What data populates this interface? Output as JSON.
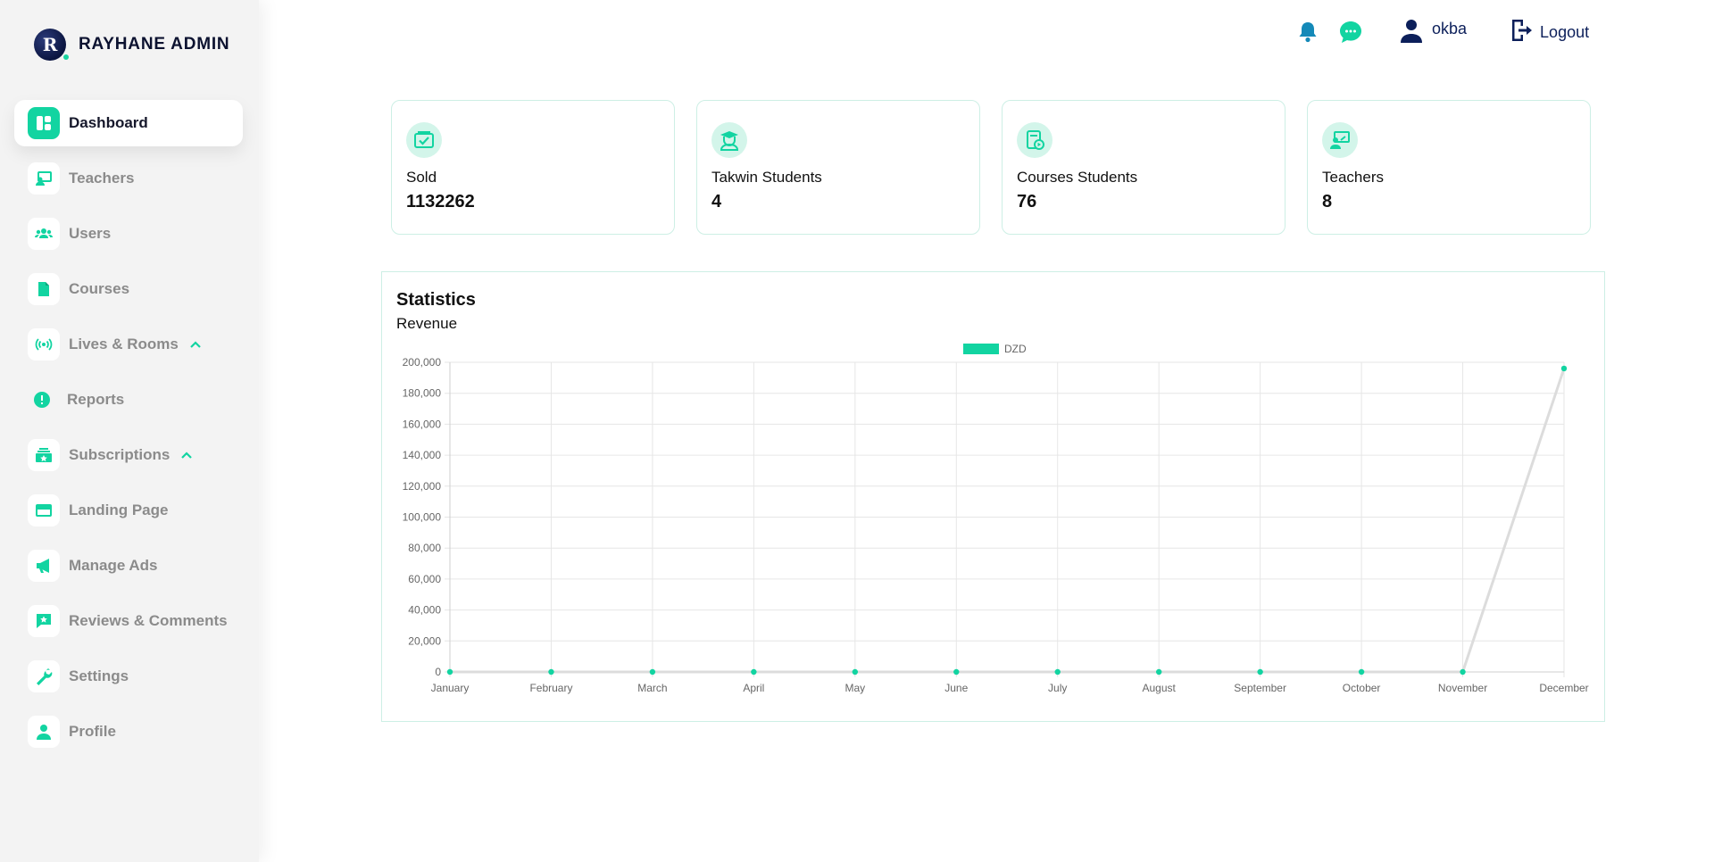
{
  "brand": {
    "name": "RAYHANE ADMIN",
    "logo_letter": "R"
  },
  "sidebar": {
    "items": [
      {
        "label": "Dashboard",
        "icon": "dashboard-icon",
        "active": true
      },
      {
        "label": "Teachers",
        "icon": "teacher-icon"
      },
      {
        "label": "Users",
        "icon": "users-icon"
      },
      {
        "label": "Courses",
        "icon": "document-icon"
      },
      {
        "label": "Lives & Rooms",
        "icon": "broadcast-icon",
        "expandable": true
      },
      {
        "label": "Reports",
        "icon": "alert-icon"
      },
      {
        "label": "Subscriptions",
        "icon": "subscription-icon",
        "expandable": true
      },
      {
        "label": "Landing Page",
        "icon": "card-icon"
      },
      {
        "label": "Manage Ads",
        "icon": "megaphone-icon"
      },
      {
        "label": "Reviews & Comments",
        "icon": "review-icon"
      },
      {
        "label": "Settings",
        "icon": "wrench-icon"
      },
      {
        "label": "Profile",
        "icon": "user-icon"
      }
    ]
  },
  "topbar": {
    "username": "okba",
    "logout_label": "Logout"
  },
  "cards": [
    {
      "label": "Sold",
      "value": "1132262",
      "icon": "money-check-icon"
    },
    {
      "label": "Takwin Students",
      "value": "4",
      "icon": "graduate-icon"
    },
    {
      "label": "Courses Students",
      "value": "76",
      "icon": "course-icon"
    },
    {
      "label": "Teachers",
      "value": "8",
      "icon": "teacher-board-icon"
    }
  ],
  "statistics": {
    "title": "Statistics",
    "subtitle": "Revenue"
  },
  "colors": {
    "accent": "#12d4a1",
    "navy": "#0c1f5a",
    "line": "#dddddd"
  },
  "chart_data": {
    "type": "line",
    "categories": [
      "January",
      "February",
      "March",
      "April",
      "May",
      "June",
      "July",
      "August",
      "September",
      "October",
      "November",
      "December"
    ],
    "series": [
      {
        "name": "DZD",
        "values": [
          0,
          0,
          0,
          0,
          0,
          0,
          0,
          0,
          0,
          0,
          0,
          196000
        ]
      }
    ],
    "ylim": [
      0,
      200000
    ],
    "yticks": [
      "0",
      "20,000",
      "40,000",
      "60,000",
      "80,000",
      "100,000",
      "120,000",
      "140,000",
      "160,000",
      "180,000",
      "200,000"
    ],
    "grid": true,
    "legend": "top-center"
  }
}
